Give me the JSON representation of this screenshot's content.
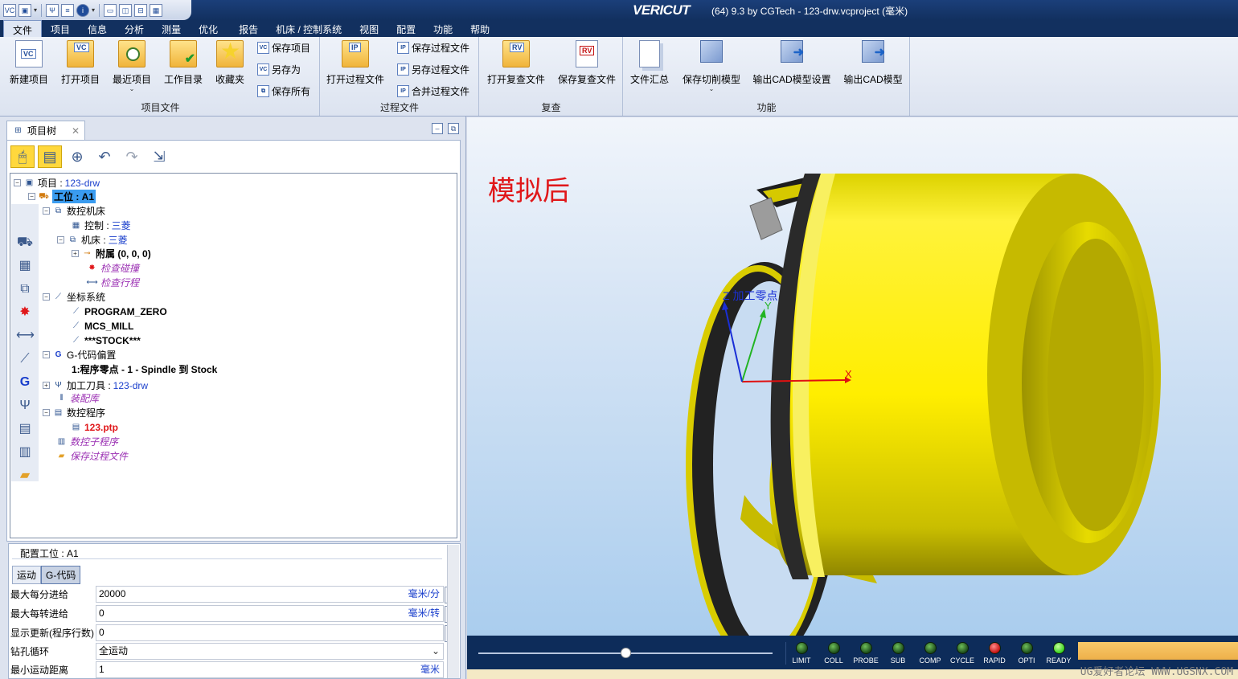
{
  "titlebar": {
    "brand": "VERICUT",
    "title": "(64)  9.3 by CGTech - 123-drw.vcproject (毫米)"
  },
  "menu": [
    "文件",
    "项目",
    "信息",
    "分析",
    "测量",
    "优化",
    "报告",
    "机床 / 控制系统",
    "视图",
    "配置",
    "功能",
    "帮助"
  ],
  "ribbon": {
    "project_file": {
      "label": "项目文件",
      "new_project": "新建项目",
      "open_project": "打开项目",
      "recent_project": "最近项目",
      "work_dir": "工作目录",
      "favorites": "收藏夹",
      "save_project": "保存项目",
      "save_as": "另存为",
      "save_all": "保存所有"
    },
    "process_file": {
      "label": "过程文件",
      "open_process": "打开过程文件",
      "save_process": "保存过程文件",
      "save_process_as": "另存过程文件",
      "merge_process": "合并过程文件"
    },
    "review": {
      "label": "复查",
      "open_review": "打开复查文件",
      "save_review": "保存复查文件"
    },
    "function": {
      "label": "功能",
      "file_summary": "文件汇总",
      "save_cut_model": "保存切削模型",
      "export_cad_settings": "输出CAD模型设置",
      "export_cad": "输出CAD模型"
    }
  },
  "tree_panel": {
    "tab_label": "项目树",
    "nodes": {
      "project": "项目 : ",
      "project_val": "123-drw",
      "setup": "工位 : A1",
      "cnc_machine": "数控机床",
      "control": "控制 : ",
      "control_val": "三菱",
      "machine": "机床 : ",
      "machine_val": "三菱",
      "attach": "附属 (0, 0, 0)",
      "check_collision": "检查碰撞",
      "check_travel": "检查行程",
      "coord_system": "坐标系统",
      "program_zero": "PROGRAM_ZERO",
      "mcs_mill": "MCS_MILL",
      "stock": "***STOCK***",
      "gcode_offset": "G-代码偏置",
      "gcode_offset_item": "1:程序零点 - 1 - Spindle 到 Stock",
      "tooling": "加工刀具 : ",
      "tooling_val": "123-drw",
      "assembly_lib": "装配库",
      "nc_programs": "数控程序",
      "nc_file": "123.ptp",
      "nc_subroutines": "数控子程序",
      "saved_process": "保存过程文件"
    }
  },
  "config": {
    "title": "配置工位 : A1",
    "tabs": [
      "运动",
      "G-代码"
    ],
    "rows": [
      {
        "label": "最大每分进给",
        "value": "20000",
        "unit": "毫米/分"
      },
      {
        "label": "最大每转进给",
        "value": "0",
        "unit": "毫米/转"
      },
      {
        "label": "显示更新(程序行数)",
        "value": "0",
        "unit": ""
      },
      {
        "label": "钻孔循环",
        "value": "全运动",
        "unit": ""
      },
      {
        "label": "最小运动距离",
        "value": "1",
        "unit": "毫米"
      }
    ]
  },
  "viewport": {
    "caption": "模拟后",
    "origin_label": "Z 加工零点",
    "axis_y": "Y",
    "axis_x": "X",
    "colors": {
      "part": "#f5e800",
      "axis_x": "#e01010",
      "axis_y": "#22b422",
      "axis_z": "#1a2fd6"
    }
  },
  "status_leds": [
    {
      "label": "LIMIT",
      "state": "off"
    },
    {
      "label": "COLL",
      "state": "off"
    },
    {
      "label": "PROBE",
      "state": "off"
    },
    {
      "label": "SUB",
      "state": "off"
    },
    {
      "label": "COMP",
      "state": "off"
    },
    {
      "label": "CYCLE",
      "state": "off"
    },
    {
      "label": "RAPID",
      "state": "red"
    },
    {
      "label": "OPTI",
      "state": "off"
    },
    {
      "label": "READY",
      "state": "green"
    }
  ],
  "watermark": "UG爱好者论坛  WWW.UGSNX.COM"
}
